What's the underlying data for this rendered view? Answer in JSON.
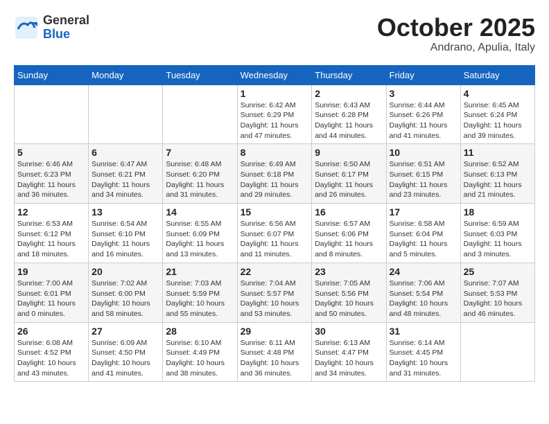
{
  "logo": {
    "general": "General",
    "blue": "Blue"
  },
  "header": {
    "month": "October 2025",
    "location": "Andrano, Apulia, Italy"
  },
  "weekdays": [
    "Sunday",
    "Monday",
    "Tuesday",
    "Wednesday",
    "Thursday",
    "Friday",
    "Saturday"
  ],
  "weeks": [
    [
      {
        "day": "",
        "info": ""
      },
      {
        "day": "",
        "info": ""
      },
      {
        "day": "",
        "info": ""
      },
      {
        "day": "1",
        "info": "Sunrise: 6:42 AM\nSunset: 6:29 PM\nDaylight: 11 hours\nand 47 minutes."
      },
      {
        "day": "2",
        "info": "Sunrise: 6:43 AM\nSunset: 6:28 PM\nDaylight: 11 hours\nand 44 minutes."
      },
      {
        "day": "3",
        "info": "Sunrise: 6:44 AM\nSunset: 6:26 PM\nDaylight: 11 hours\nand 41 minutes."
      },
      {
        "day": "4",
        "info": "Sunrise: 6:45 AM\nSunset: 6:24 PM\nDaylight: 11 hours\nand 39 minutes."
      }
    ],
    [
      {
        "day": "5",
        "info": "Sunrise: 6:46 AM\nSunset: 6:23 PM\nDaylight: 11 hours\nand 36 minutes."
      },
      {
        "day": "6",
        "info": "Sunrise: 6:47 AM\nSunset: 6:21 PM\nDaylight: 11 hours\nand 34 minutes."
      },
      {
        "day": "7",
        "info": "Sunrise: 6:48 AM\nSunset: 6:20 PM\nDaylight: 11 hours\nand 31 minutes."
      },
      {
        "day": "8",
        "info": "Sunrise: 6:49 AM\nSunset: 6:18 PM\nDaylight: 11 hours\nand 29 minutes."
      },
      {
        "day": "9",
        "info": "Sunrise: 6:50 AM\nSunset: 6:17 PM\nDaylight: 11 hours\nand 26 minutes."
      },
      {
        "day": "10",
        "info": "Sunrise: 6:51 AM\nSunset: 6:15 PM\nDaylight: 11 hours\nand 23 minutes."
      },
      {
        "day": "11",
        "info": "Sunrise: 6:52 AM\nSunset: 6:13 PM\nDaylight: 11 hours\nand 21 minutes."
      }
    ],
    [
      {
        "day": "12",
        "info": "Sunrise: 6:53 AM\nSunset: 6:12 PM\nDaylight: 11 hours\nand 18 minutes."
      },
      {
        "day": "13",
        "info": "Sunrise: 6:54 AM\nSunset: 6:10 PM\nDaylight: 11 hours\nand 16 minutes."
      },
      {
        "day": "14",
        "info": "Sunrise: 6:55 AM\nSunset: 6:09 PM\nDaylight: 11 hours\nand 13 minutes."
      },
      {
        "day": "15",
        "info": "Sunrise: 6:56 AM\nSunset: 6:07 PM\nDaylight: 11 hours\nand 11 minutes."
      },
      {
        "day": "16",
        "info": "Sunrise: 6:57 AM\nSunset: 6:06 PM\nDaylight: 11 hours\nand 8 minutes."
      },
      {
        "day": "17",
        "info": "Sunrise: 6:58 AM\nSunset: 6:04 PM\nDaylight: 11 hours\nand 5 minutes."
      },
      {
        "day": "18",
        "info": "Sunrise: 6:59 AM\nSunset: 6:03 PM\nDaylight: 11 hours\nand 3 minutes."
      }
    ],
    [
      {
        "day": "19",
        "info": "Sunrise: 7:00 AM\nSunset: 6:01 PM\nDaylight: 11 hours\nand 0 minutes."
      },
      {
        "day": "20",
        "info": "Sunrise: 7:02 AM\nSunset: 6:00 PM\nDaylight: 10 hours\nand 58 minutes."
      },
      {
        "day": "21",
        "info": "Sunrise: 7:03 AM\nSunset: 5:59 PM\nDaylight: 10 hours\nand 55 minutes."
      },
      {
        "day": "22",
        "info": "Sunrise: 7:04 AM\nSunset: 5:57 PM\nDaylight: 10 hours\nand 53 minutes."
      },
      {
        "day": "23",
        "info": "Sunrise: 7:05 AM\nSunset: 5:56 PM\nDaylight: 10 hours\nand 50 minutes."
      },
      {
        "day": "24",
        "info": "Sunrise: 7:06 AM\nSunset: 5:54 PM\nDaylight: 10 hours\nand 48 minutes."
      },
      {
        "day": "25",
        "info": "Sunrise: 7:07 AM\nSunset: 5:53 PM\nDaylight: 10 hours\nand 46 minutes."
      }
    ],
    [
      {
        "day": "26",
        "info": "Sunrise: 6:08 AM\nSunset: 4:52 PM\nDaylight: 10 hours\nand 43 minutes."
      },
      {
        "day": "27",
        "info": "Sunrise: 6:09 AM\nSunset: 4:50 PM\nDaylight: 10 hours\nand 41 minutes."
      },
      {
        "day": "28",
        "info": "Sunrise: 6:10 AM\nSunset: 4:49 PM\nDaylight: 10 hours\nand 38 minutes."
      },
      {
        "day": "29",
        "info": "Sunrise: 6:11 AM\nSunset: 4:48 PM\nDaylight: 10 hours\nand 36 minutes."
      },
      {
        "day": "30",
        "info": "Sunrise: 6:13 AM\nSunset: 4:47 PM\nDaylight: 10 hours\nand 34 minutes."
      },
      {
        "day": "31",
        "info": "Sunrise: 6:14 AM\nSunset: 4:45 PM\nDaylight: 10 hours\nand 31 minutes."
      },
      {
        "day": "",
        "info": ""
      }
    ]
  ]
}
